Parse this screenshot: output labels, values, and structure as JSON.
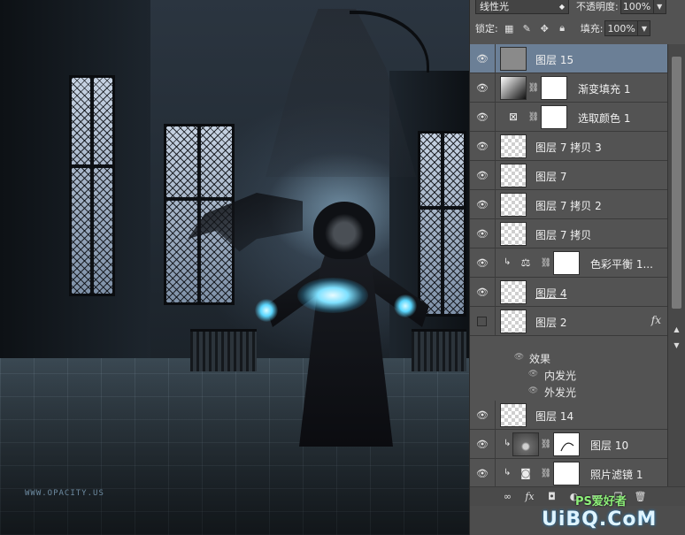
{
  "canvas": {
    "watermark": "WWW.OPACITY.US"
  },
  "options": {
    "blend_mode": "线性光",
    "opacity_label": "不透明度:",
    "opacity_value": "100%",
    "lock_label": "锁定:",
    "fill_label": "填充:",
    "fill_value": "100%"
  },
  "layers": [
    {
      "name": "图层 15",
      "thumb": "gray",
      "visible": true,
      "selected": true
    },
    {
      "name": "渐变填充 1",
      "thumb": "grad",
      "mask": true,
      "visible": true
    },
    {
      "name": "选取颜色 1",
      "adj_icon": "selective-color",
      "mask": true,
      "visible": true
    },
    {
      "name": "图层 7 拷贝 3",
      "thumb": "checker",
      "visible": true
    },
    {
      "name": "图层 7",
      "thumb": "checker",
      "visible": true
    },
    {
      "name": "图层 7 拷贝 2",
      "thumb": "checker",
      "visible": true
    },
    {
      "name": "图层 7 拷贝",
      "thumb": "checker",
      "visible": true
    },
    {
      "name": "色彩平衡 1...",
      "adj_icon": "color-balance",
      "mask": true,
      "clipped": true,
      "visible": true
    },
    {
      "name": "图层 4",
      "thumb": "checker",
      "visible": true
    },
    {
      "name": "图层 2",
      "thumb": "checker",
      "visible": false,
      "fx": "fx"
    },
    {
      "name": "图层 14",
      "thumb": "checker",
      "visible": true
    },
    {
      "name": "图层 10",
      "thumb": "photo",
      "mask": true,
      "clipped": true,
      "visible": true
    },
    {
      "name": "照片滤镜 1",
      "adj_icon": "photo-filter",
      "mask": true,
      "clipped": true,
      "visible": true
    }
  ],
  "effects": {
    "title": "效果",
    "items": [
      "内发光",
      "外发光"
    ]
  },
  "bottom_icons": [
    "link-icon",
    "fx-icon",
    "mask-icon",
    "adjustment-icon",
    "folder-icon",
    "new-layer-icon",
    "trash-icon"
  ],
  "watermark_brand": "UiBQ.CoM",
  "watermark_brand2": "PS爱好者"
}
